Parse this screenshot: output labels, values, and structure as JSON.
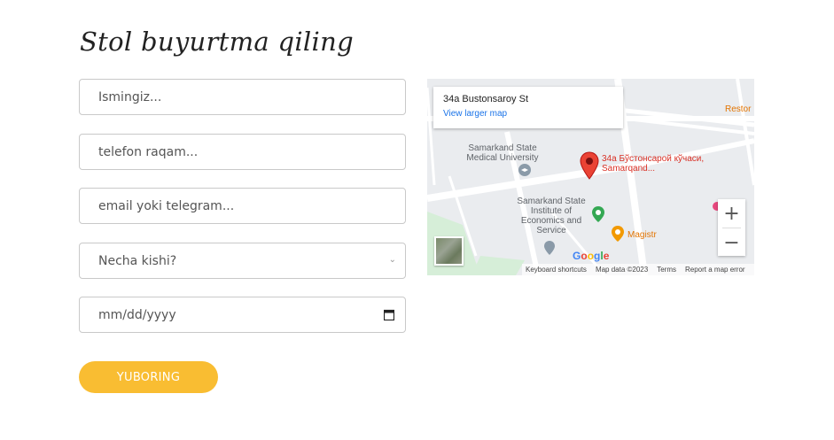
{
  "form": {
    "title": "Stol buyurtma qiling",
    "name_placeholder": "Ismingiz...",
    "phone_placeholder": "telefon raqam...",
    "email_placeholder": "email yoki telegram...",
    "guests_selected": "Necha kishi?",
    "date_placeholder": "mm/dd/yyyy",
    "submit_label": "YUBORING"
  },
  "map": {
    "place_title": "34a Bustonsaroy St",
    "view_larger": "View larger map",
    "pin_label": "34a Бўстонсарой кўчаси, Samarqand...",
    "labels": {
      "medical": "Samarkand State Medical University",
      "institute": "Samarkand State Institute of Economics and Service",
      "magistr": "Magistr",
      "restor": "Restor"
    },
    "google": "Google",
    "footer": {
      "shortcuts": "Keyboard shortcuts",
      "map_data": "Map data ©2023",
      "terms": "Terms",
      "report": "Report a map error"
    },
    "zoom_in": "+",
    "zoom_out": "−"
  },
  "colors": {
    "accent": "#f9bd32",
    "link": "#1a73e8",
    "pin": "#d93025"
  }
}
